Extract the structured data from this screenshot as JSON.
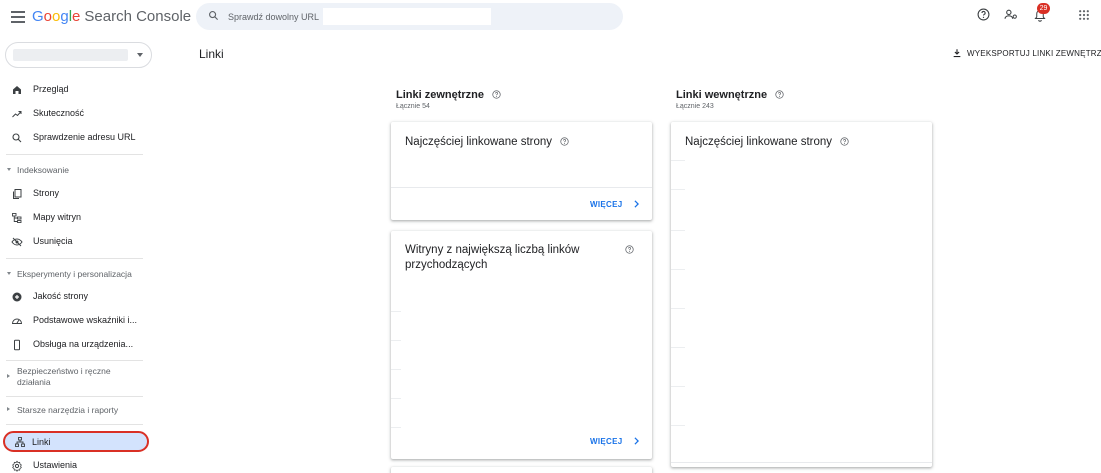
{
  "app": {
    "logo_google": "Google",
    "logo_product": "Search Console",
    "search_placeholder": "Sprawdź dowolny URL",
    "notifications_count": "29"
  },
  "icons": {
    "menu": "hamburger-menu-icon",
    "search": "search-icon",
    "help": "help-icon",
    "users": "manage-users-icon",
    "notifications": "bell-icon",
    "apps": "apps-grid-icon"
  },
  "sidebar": {
    "items": [
      {
        "label": "Przegląd",
        "icon": "home-icon"
      },
      {
        "label": "Skuteczność",
        "icon": "trend-icon"
      },
      {
        "label": "Sprawdzenie adresu URL",
        "icon": "search-icon"
      }
    ],
    "section_indexing": "Indeksowanie",
    "indexing_items": [
      {
        "label": "Strony",
        "icon": "pages-icon"
      },
      {
        "label": "Mapy witryn",
        "icon": "sitemap-icon"
      },
      {
        "label": "Usunięcia",
        "icon": "removals-icon"
      }
    ],
    "section_experience": "Eksperymenty i personalizacja",
    "experience_items": [
      {
        "label": "Jakość strony",
        "icon": "page-quality-icon"
      },
      {
        "label": "Podstawowe wskaźniki i...",
        "icon": "gauge-icon"
      },
      {
        "label": "Obsługa na urządzenia...",
        "icon": "mobile-icon"
      }
    ],
    "section_security": "Bezpieczeństwo i ręczne działania",
    "section_legacy": "Starsze narzędzia i raporty",
    "links_label": "Linki",
    "settings_label": "Ustawienia"
  },
  "page": {
    "title": "Linki",
    "export_label": "WYEKSPORTUJ LINKI ZEWNĘTRZ"
  },
  "external": {
    "title": "Linki zewnętrzne",
    "total": "Łącznie 54",
    "card1_title": "Najczęściej linkowane strony",
    "card1_more": "WIĘCEJ",
    "card2_title": "Witryny z największą liczbą linków przychodzących",
    "card2_more": "WIĘCEJ"
  },
  "internal": {
    "title": "Linki wewnętrzne",
    "total": "Łącznie 243",
    "card1_title": "Najczęściej linkowane strony"
  },
  "colors": {
    "accent": "#1a73e8",
    "active_bg": "#d3e3fd",
    "highlight": "#d93025"
  }
}
